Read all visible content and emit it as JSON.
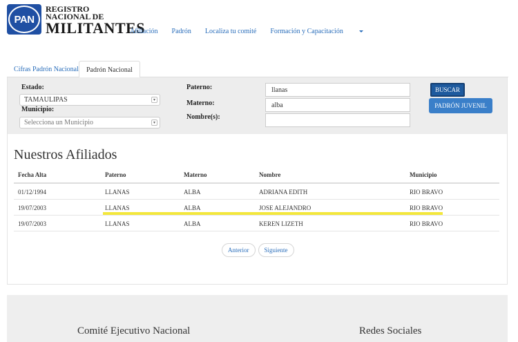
{
  "header": {
    "logo_text": "PAN",
    "brand_line1": "REGISTRO",
    "brand_line2": "NACIONAL DE",
    "brand_line3": "MILITANTES",
    "nav": [
      "Afiliación",
      "Padrón",
      "Localiza tu comité",
      "Formación y Capacitación"
    ]
  },
  "tabs": [
    "Cifras Padrón Nacional",
    "Padrón Nacional"
  ],
  "search": {
    "estado_label": "Estado:",
    "estado_value": "TAMAULIPAS",
    "municipio_label": "Municipio:",
    "municipio_placeholder": "Selecciona un Municipio",
    "paterno_label": "Paterno:",
    "paterno_value": "llanas",
    "materno_label": "Materno:",
    "materno_value": "alba",
    "nombre_label": "Nombre(s):",
    "nombre_value": "",
    "buscar_label": "BUSCAR",
    "juvenil_label": "PADRÓN JUVENIL"
  },
  "results": {
    "title": "Nuestros Afiliados",
    "columns": [
      "Fecha Alta",
      "Paterno",
      "Materno",
      "Nombre",
      "Municipio"
    ],
    "rows": [
      [
        "01/12/1994",
        "LLANAS",
        "ALBA",
        "ADRIANA EDITH",
        "RIO BRAVO"
      ],
      [
        "19/07/2003",
        "LLANAS",
        "ALBA",
        "JOSE ALEJANDRO",
        "RIO BRAVO"
      ],
      [
        "19/07/2003",
        "LLANAS",
        "ALBA",
        "KEREN LIZETH",
        "RIO BRAVO"
      ]
    ],
    "highlight_color": "#f3e73b"
  },
  "pager": {
    "prev_label": "Anterior",
    "next_label": "Siguiente"
  },
  "footer": {
    "left_title": "Comité Ejecutivo Nacional",
    "right_title": "Redes Sociales"
  }
}
